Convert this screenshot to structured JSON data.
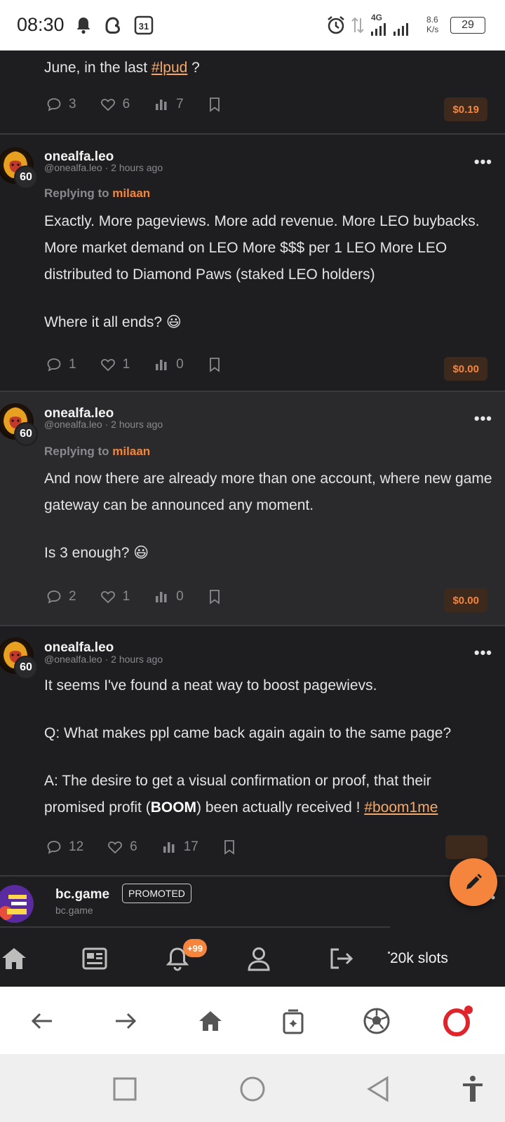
{
  "status_bar": {
    "time": "08:30",
    "calendar_day": "31",
    "network": "4G",
    "speed_value": "8.6",
    "speed_unit": "K/s",
    "battery": "29"
  },
  "posts": [
    {
      "body_prefix": "June, in the last ",
      "tag": "#lpud",
      "body_suffix": " ?",
      "comments": "3",
      "likes": "6",
      "views": "7",
      "payout": "$0.19"
    },
    {
      "username": "onealfa.leo",
      "handle": "@onealfa.leo",
      "time": "2 hours ago",
      "reputation": "60",
      "replying_label": "Replying to",
      "replying_to": "milaan",
      "paragraph1": "Exactly. More pageviews. More add revenue. More LEO buybacks. More market demand on LEO More $$$ per 1 LEO More LEO distributed to Diamond Paws (staked LEO holders)",
      "paragraph2": "Where it all ends? 😃",
      "comments": "1",
      "likes": "1",
      "views": "0",
      "payout": "$0.00"
    },
    {
      "username": "onealfa.leo",
      "handle": "@onealfa.leo",
      "time": "2 hours ago",
      "reputation": "60",
      "replying_label": "Replying to",
      "replying_to": "milaan",
      "paragraph1": "And now there are already more than one account, where new game gateway can be announced any moment.",
      "paragraph2": "Is 3 enough? 😃",
      "comments": "2",
      "likes": "1",
      "views": "0",
      "payout": "$0.00"
    },
    {
      "username": "onealfa.leo",
      "handle": "@onealfa.leo",
      "time": "2 hours ago",
      "reputation": "60",
      "paragraph1": "It seems I've found a neat way to boost pagewievs.",
      "paragraph2": "Q: What makes ppl came back again again to the same page?",
      "p3_prefix": "A: The desire to get a visual confirmation or proof, that their promised profit (",
      "p3_bold": "BOOM",
      "p3_mid": ") been actually received ! ",
      "p3_tag": "#boom1me",
      "comments": "12",
      "likes": "6",
      "views": "17"
    }
  ],
  "promoted": {
    "name": "bc.game",
    "domain": "bc.game",
    "label": "PROMOTED"
  },
  "app_nav": {
    "notification_count": "+99",
    "ad_text": "20k slots"
  },
  "colors": {
    "accent": "#f5853d",
    "background": "#1e1e20",
    "highlight_background": "#2a2a2c"
  }
}
